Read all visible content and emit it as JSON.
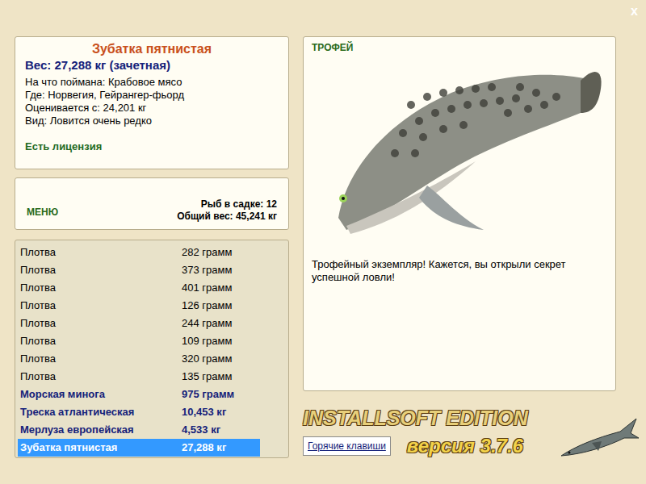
{
  "window": {
    "close": "x"
  },
  "info": {
    "title": "Зубатка пятнистая",
    "weight": "Вес: 27,288 кг (зачетная)",
    "details": [
      "На что поймана: Крабовое мясо",
      "Где: Норвегия, Гейрангер-фьорд",
      "Оценивается с: 24,201 кг",
      "Вид: Ловится очень редко"
    ],
    "license": "Есть лицензия"
  },
  "menu": {
    "label": "МЕНЮ",
    "count": "Рыб в садке: 12",
    "total": "Общий вес: 45,241 кг"
  },
  "catch": [
    {
      "name": "Плотва",
      "weight": "282 грамм",
      "kind": "common",
      "selected": false
    },
    {
      "name": "Плотва",
      "weight": "373 грамм",
      "kind": "common",
      "selected": false
    },
    {
      "name": "Плотва",
      "weight": "401 грамм",
      "kind": "common",
      "selected": false
    },
    {
      "name": "Плотва",
      "weight": "126 грамм",
      "kind": "common",
      "selected": false
    },
    {
      "name": "Плотва",
      "weight": "244 грамм",
      "kind": "common",
      "selected": false
    },
    {
      "name": "Плотва",
      "weight": "109 грамм",
      "kind": "common",
      "selected": false
    },
    {
      "name": "Плотва",
      "weight": "320 грамм",
      "kind": "common",
      "selected": false
    },
    {
      "name": "Плотва",
      "weight": "135 грамм",
      "kind": "common",
      "selected": false
    },
    {
      "name": "Морская минога",
      "weight": "975 грамм",
      "kind": "rare",
      "selected": false
    },
    {
      "name": "Треска атлантическая",
      "weight": "10,453 кг",
      "kind": "rare",
      "selected": false
    },
    {
      "name": "Мерлуза европейская",
      "weight": "4,533 кг",
      "kind": "rare",
      "selected": false
    },
    {
      "name": "Зубатка пятнистая",
      "weight": "27,288 кг",
      "kind": "rare",
      "selected": true
    }
  ],
  "trophy": {
    "label": "ТРОФЕЙ",
    "message": "Трофейный экземпляр! Кажется, вы открыли секрет успешной ловли!"
  },
  "logo": {
    "title": "INSTALLSOFT EDITION",
    "version": "версия 3.7.6"
  },
  "buttons": [
    "Горячие клавиши"
  ]
}
